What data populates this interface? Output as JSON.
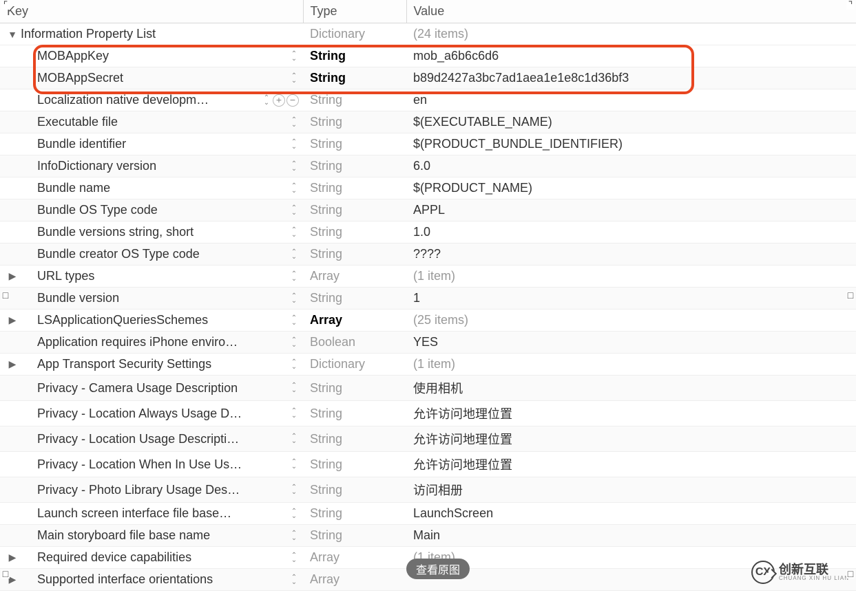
{
  "columns": {
    "key": "Key",
    "type": "Type",
    "value": "Value"
  },
  "root": {
    "key": "Information Property List",
    "type": "Dictionary",
    "value": "(24 items)"
  },
  "rows": [
    {
      "key": "MOBAppKey",
      "type": "String",
      "value": "mob_a6b6c6d6",
      "indent": 1,
      "disc": "",
      "type_dim": false,
      "val_dim": false,
      "stepper": true,
      "plusminus": false,
      "highlight": true
    },
    {
      "key": "MOBAppSecret",
      "type": "String",
      "value": "b89d2427a3bc7ad1aea1e1e8c1d36bf3",
      "indent": 1,
      "disc": "",
      "type_dim": false,
      "val_dim": false,
      "stepper": true,
      "plusminus": false,
      "highlight": true
    },
    {
      "key": "Localization native developm…",
      "type": "String",
      "value": "en",
      "indent": 1,
      "disc": "",
      "type_dim": true,
      "val_dim": false,
      "stepper": true,
      "plusminus": true
    },
    {
      "key": "Executable file",
      "type": "String",
      "value": "$(EXECUTABLE_NAME)",
      "indent": 1,
      "disc": "",
      "type_dim": true,
      "val_dim": false,
      "stepper": true,
      "plusminus": false
    },
    {
      "key": "Bundle identifier",
      "type": "String",
      "value": "$(PRODUCT_BUNDLE_IDENTIFIER)",
      "indent": 1,
      "disc": "",
      "type_dim": true,
      "val_dim": false,
      "stepper": true,
      "plusminus": false
    },
    {
      "key": "InfoDictionary version",
      "type": "String",
      "value": "6.0",
      "indent": 1,
      "disc": "",
      "type_dim": true,
      "val_dim": false,
      "stepper": true,
      "plusminus": false
    },
    {
      "key": "Bundle name",
      "type": "String",
      "value": "$(PRODUCT_NAME)",
      "indent": 1,
      "disc": "",
      "type_dim": true,
      "val_dim": false,
      "stepper": true,
      "plusminus": false
    },
    {
      "key": "Bundle OS Type code",
      "type": "String",
      "value": "APPL",
      "indent": 1,
      "disc": "",
      "type_dim": true,
      "val_dim": false,
      "stepper": true,
      "plusminus": false
    },
    {
      "key": "Bundle versions string, short",
      "type": "String",
      "value": "1.0",
      "indent": 1,
      "disc": "",
      "type_dim": true,
      "val_dim": false,
      "stepper": true,
      "plusminus": false
    },
    {
      "key": "Bundle creator OS Type code",
      "type": "String",
      "value": "????",
      "indent": 1,
      "disc": "",
      "type_dim": true,
      "val_dim": false,
      "stepper": true,
      "plusminus": false
    },
    {
      "key": "URL types",
      "type": "Array",
      "value": "(1 item)",
      "indent": 1,
      "disc": "▶",
      "type_dim": true,
      "val_dim": true,
      "stepper": true,
      "plusminus": false
    },
    {
      "key": "Bundle version",
      "type": "String",
      "value": "1",
      "indent": 1,
      "disc": "",
      "type_dim": true,
      "val_dim": false,
      "stepper": true,
      "plusminus": false
    },
    {
      "key": "LSApplicationQueriesSchemes",
      "type": "Array",
      "value": "(25 items)",
      "indent": 1,
      "disc": "▶",
      "type_dim": false,
      "val_dim": true,
      "stepper": true,
      "plusminus": false
    },
    {
      "key": "Application requires iPhone enviro…",
      "type": "Boolean",
      "value": "YES",
      "indent": 1,
      "disc": "",
      "type_dim": true,
      "val_dim": false,
      "stepper": true,
      "plusminus": false
    },
    {
      "key": "App Transport Security Settings",
      "type": "Dictionary",
      "value": "(1 item)",
      "indent": 1,
      "disc": "▶",
      "type_dim": true,
      "val_dim": true,
      "stepper": true,
      "plusminus": false
    },
    {
      "key": "Privacy - Camera Usage Description",
      "type": "String",
      "value": "使用相机",
      "indent": 1,
      "disc": "",
      "type_dim": true,
      "val_dim": false,
      "stepper": true,
      "plusminus": false
    },
    {
      "key": "Privacy - Location Always Usage D…",
      "type": "String",
      "value": "允许访问地理位置",
      "indent": 1,
      "disc": "",
      "type_dim": true,
      "val_dim": false,
      "stepper": true,
      "plusminus": false
    },
    {
      "key": "Privacy - Location Usage Descripti…",
      "type": "String",
      "value": "允许访问地理位置",
      "indent": 1,
      "disc": "",
      "type_dim": true,
      "val_dim": false,
      "stepper": true,
      "plusminus": false
    },
    {
      "key": "Privacy - Location When In Use Us…",
      "type": "String",
      "value": "允许访问地理位置",
      "indent": 1,
      "disc": "",
      "type_dim": true,
      "val_dim": false,
      "stepper": true,
      "plusminus": false
    },
    {
      "key": "Privacy - Photo Library Usage Des…",
      "type": "String",
      "value": "访问相册",
      "indent": 1,
      "disc": "",
      "type_dim": true,
      "val_dim": false,
      "stepper": true,
      "plusminus": false
    },
    {
      "key": "Launch screen interface file base…",
      "type": "String",
      "value": "LaunchScreen",
      "indent": 1,
      "disc": "",
      "type_dim": true,
      "val_dim": false,
      "stepper": true,
      "plusminus": false
    },
    {
      "key": "Main storyboard file base name",
      "type": "String",
      "value": "Main",
      "indent": 1,
      "disc": "",
      "type_dim": true,
      "val_dim": false,
      "stepper": true,
      "plusminus": false
    },
    {
      "key": "Required device capabilities",
      "type": "Array",
      "value": "(1 item)",
      "indent": 1,
      "disc": "▶",
      "type_dim": true,
      "val_dim": true,
      "stepper": true,
      "plusminus": false
    },
    {
      "key": "Supported interface orientations",
      "type": "Array",
      "value": "",
      "indent": 1,
      "disc": "▶",
      "type_dim": true,
      "val_dim": true,
      "stepper": true,
      "plusminus": false
    }
  ],
  "tooltip": "查看原图",
  "logo": {
    "icon": "CX",
    "cn": "创新互联",
    "en": "CHUANG XIN HU LIAN"
  }
}
